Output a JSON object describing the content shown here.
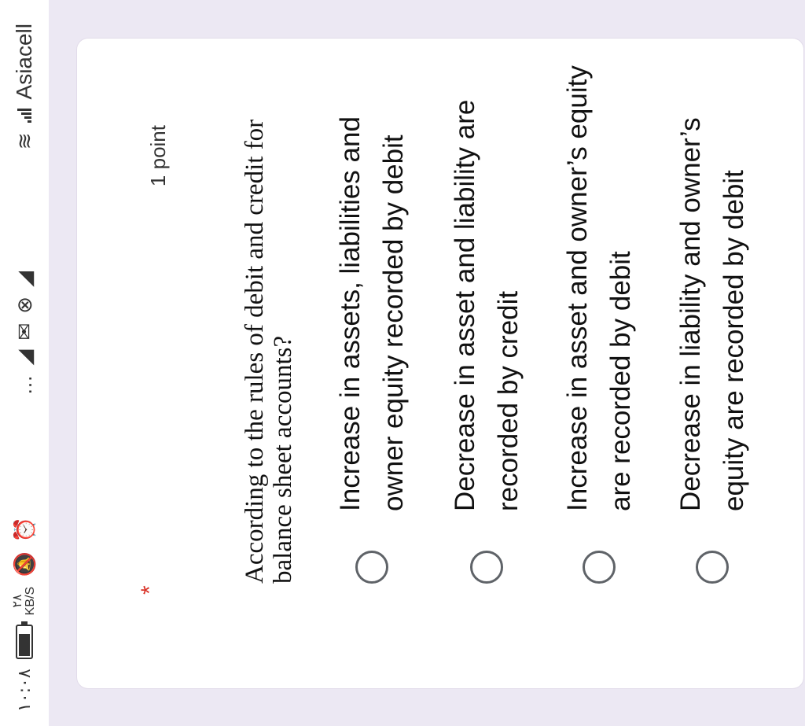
{
  "status_bar": {
    "time": "١٠:٠٨",
    "speed": "٢٨\nKB/S",
    "carrier": "Asiacell",
    "icons": [
      "alarm-icon",
      "mute-icon",
      "telegram-icon",
      "telegram-icon",
      "gmail-icon",
      "close-circle-icon",
      "telegram-icon",
      "wifi-icon",
      "signal-icon"
    ]
  },
  "question": {
    "required_mark": "*",
    "points": "1 point",
    "text": "According to the rules of debit and credit for balance sheet accounts?"
  },
  "options": [
    {
      "label": "Increase in assets, liabilities and owner equity recorded by debit"
    },
    {
      "label": "Decrease in asset and liability are recorded by credit"
    },
    {
      "label": "Increase in asset and owner’s equity are recorded by debit"
    },
    {
      "label": "Decrease in liability and owner’s equity are recorded by debit"
    }
  ]
}
